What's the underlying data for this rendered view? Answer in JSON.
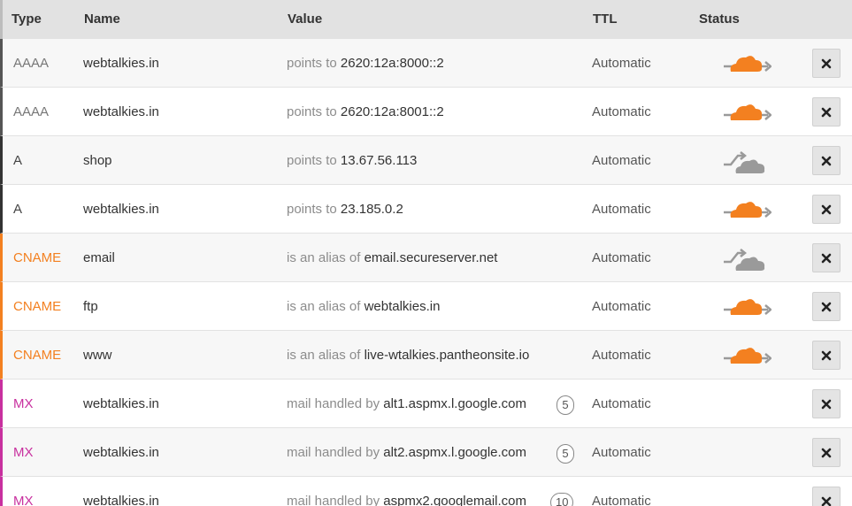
{
  "columns": {
    "type": "Type",
    "name": "Name",
    "value": "Value",
    "ttl": "TTL",
    "status": "Status"
  },
  "records": [
    {
      "type": "AAAA",
      "name": "webtalkies.in",
      "prefix": "points to",
      "target": "2620:12a:8000::2",
      "priority": "",
      "ttl": "Automatic",
      "status": "proxied-cloud-icon"
    },
    {
      "type": "AAAA",
      "name": "webtalkies.in",
      "prefix": "points to",
      "target": "2620:12a:8001::2",
      "priority": "",
      "ttl": "Automatic",
      "status": "proxied-cloud-icon"
    },
    {
      "type": "A",
      "name": "shop",
      "prefix": "points to",
      "target": "13.67.56.113",
      "priority": "",
      "ttl": "Automatic",
      "status": "dns-only-cloud-icon"
    },
    {
      "type": "A",
      "name": "webtalkies.in",
      "prefix": "points to",
      "target": "23.185.0.2",
      "priority": "",
      "ttl": "Automatic",
      "status": "proxied-cloud-icon"
    },
    {
      "type": "CNAME",
      "name": "email",
      "prefix": "is an alias of",
      "target": "email.secureserver.net",
      "priority": "",
      "ttl": "Automatic",
      "status": "dns-only-cloud-icon"
    },
    {
      "type": "CNAME",
      "name": "ftp",
      "prefix": "is an alias of",
      "target": "webtalkies.in",
      "priority": "",
      "ttl": "Automatic",
      "status": "proxied-cloud-icon"
    },
    {
      "type": "CNAME",
      "name": "www",
      "prefix": "is an alias of",
      "target": "live-wtalkies.pantheonsite.io",
      "priority": "",
      "ttl": "Automatic",
      "status": "proxied-cloud-icon"
    },
    {
      "type": "MX",
      "name": "webtalkies.in",
      "prefix": "mail handled by",
      "target": "alt1.aspmx.l.google.com",
      "priority": "5",
      "ttl": "Automatic",
      "status": ""
    },
    {
      "type": "MX",
      "name": "webtalkies.in",
      "prefix": "mail handled by",
      "target": "alt2.aspmx.l.google.com",
      "priority": "5",
      "ttl": "Automatic",
      "status": ""
    },
    {
      "type": "MX",
      "name": "webtalkies.in",
      "prefix": "mail handled by",
      "target": "aspmx2.googlemail.com",
      "priority": "10",
      "ttl": "Automatic",
      "status": ""
    }
  ],
  "colors": {
    "proxied": "#f38020",
    "dns_only": "#9a9a9a",
    "cname": "#f38020",
    "mx": "#c8309f"
  },
  "icons": {
    "delete": "close-x-icon"
  }
}
